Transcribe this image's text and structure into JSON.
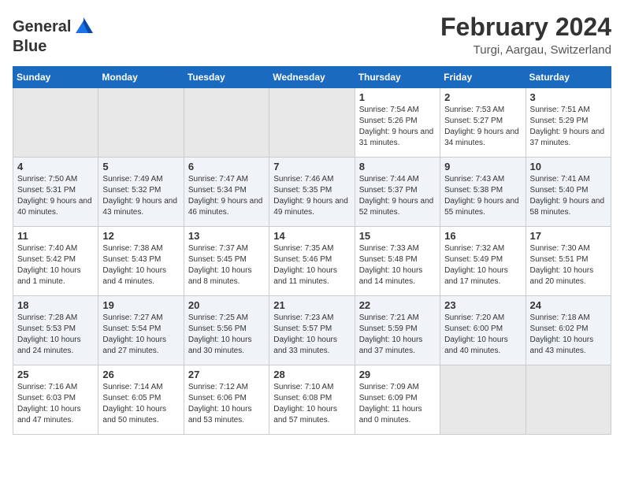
{
  "header": {
    "logo_general": "General",
    "logo_blue": "Blue",
    "title": "February 2024",
    "subtitle": "Turgi, Aargau, Switzerland"
  },
  "calendar": {
    "days_of_week": [
      "Sunday",
      "Monday",
      "Tuesday",
      "Wednesday",
      "Thursday",
      "Friday",
      "Saturday"
    ],
    "weeks": [
      [
        {
          "day": "",
          "info": ""
        },
        {
          "day": "",
          "info": ""
        },
        {
          "day": "",
          "info": ""
        },
        {
          "day": "",
          "info": ""
        },
        {
          "day": "1",
          "info": "Sunrise: 7:54 AM\nSunset: 5:26 PM\nDaylight: 9 hours\nand 31 minutes."
        },
        {
          "day": "2",
          "info": "Sunrise: 7:53 AM\nSunset: 5:27 PM\nDaylight: 9 hours\nand 34 minutes."
        },
        {
          "day": "3",
          "info": "Sunrise: 7:51 AM\nSunset: 5:29 PM\nDaylight: 9 hours\nand 37 minutes."
        }
      ],
      [
        {
          "day": "4",
          "info": "Sunrise: 7:50 AM\nSunset: 5:31 PM\nDaylight: 9 hours\nand 40 minutes."
        },
        {
          "day": "5",
          "info": "Sunrise: 7:49 AM\nSunset: 5:32 PM\nDaylight: 9 hours\nand 43 minutes."
        },
        {
          "day": "6",
          "info": "Sunrise: 7:47 AM\nSunset: 5:34 PM\nDaylight: 9 hours\nand 46 minutes."
        },
        {
          "day": "7",
          "info": "Sunrise: 7:46 AM\nSunset: 5:35 PM\nDaylight: 9 hours\nand 49 minutes."
        },
        {
          "day": "8",
          "info": "Sunrise: 7:44 AM\nSunset: 5:37 PM\nDaylight: 9 hours\nand 52 minutes."
        },
        {
          "day": "9",
          "info": "Sunrise: 7:43 AM\nSunset: 5:38 PM\nDaylight: 9 hours\nand 55 minutes."
        },
        {
          "day": "10",
          "info": "Sunrise: 7:41 AM\nSunset: 5:40 PM\nDaylight: 9 hours\nand 58 minutes."
        }
      ],
      [
        {
          "day": "11",
          "info": "Sunrise: 7:40 AM\nSunset: 5:42 PM\nDaylight: 10 hours\nand 1 minute."
        },
        {
          "day": "12",
          "info": "Sunrise: 7:38 AM\nSunset: 5:43 PM\nDaylight: 10 hours\nand 4 minutes."
        },
        {
          "day": "13",
          "info": "Sunrise: 7:37 AM\nSunset: 5:45 PM\nDaylight: 10 hours\nand 8 minutes."
        },
        {
          "day": "14",
          "info": "Sunrise: 7:35 AM\nSunset: 5:46 PM\nDaylight: 10 hours\nand 11 minutes."
        },
        {
          "day": "15",
          "info": "Sunrise: 7:33 AM\nSunset: 5:48 PM\nDaylight: 10 hours\nand 14 minutes."
        },
        {
          "day": "16",
          "info": "Sunrise: 7:32 AM\nSunset: 5:49 PM\nDaylight: 10 hours\nand 17 minutes."
        },
        {
          "day": "17",
          "info": "Sunrise: 7:30 AM\nSunset: 5:51 PM\nDaylight: 10 hours\nand 20 minutes."
        }
      ],
      [
        {
          "day": "18",
          "info": "Sunrise: 7:28 AM\nSunset: 5:53 PM\nDaylight: 10 hours\nand 24 minutes."
        },
        {
          "day": "19",
          "info": "Sunrise: 7:27 AM\nSunset: 5:54 PM\nDaylight: 10 hours\nand 27 minutes."
        },
        {
          "day": "20",
          "info": "Sunrise: 7:25 AM\nSunset: 5:56 PM\nDaylight: 10 hours\nand 30 minutes."
        },
        {
          "day": "21",
          "info": "Sunrise: 7:23 AM\nSunset: 5:57 PM\nDaylight: 10 hours\nand 33 minutes."
        },
        {
          "day": "22",
          "info": "Sunrise: 7:21 AM\nSunset: 5:59 PM\nDaylight: 10 hours\nand 37 minutes."
        },
        {
          "day": "23",
          "info": "Sunrise: 7:20 AM\nSunset: 6:00 PM\nDaylight: 10 hours\nand 40 minutes."
        },
        {
          "day": "24",
          "info": "Sunrise: 7:18 AM\nSunset: 6:02 PM\nDaylight: 10 hours\nand 43 minutes."
        }
      ],
      [
        {
          "day": "25",
          "info": "Sunrise: 7:16 AM\nSunset: 6:03 PM\nDaylight: 10 hours\nand 47 minutes."
        },
        {
          "day": "26",
          "info": "Sunrise: 7:14 AM\nSunset: 6:05 PM\nDaylight: 10 hours\nand 50 minutes."
        },
        {
          "day": "27",
          "info": "Sunrise: 7:12 AM\nSunset: 6:06 PM\nDaylight: 10 hours\nand 53 minutes."
        },
        {
          "day": "28",
          "info": "Sunrise: 7:10 AM\nSunset: 6:08 PM\nDaylight: 10 hours\nand 57 minutes."
        },
        {
          "day": "29",
          "info": "Sunrise: 7:09 AM\nSunset: 6:09 PM\nDaylight: 11 hours\nand 0 minutes."
        },
        {
          "day": "",
          "info": ""
        },
        {
          "day": "",
          "info": ""
        }
      ]
    ]
  }
}
